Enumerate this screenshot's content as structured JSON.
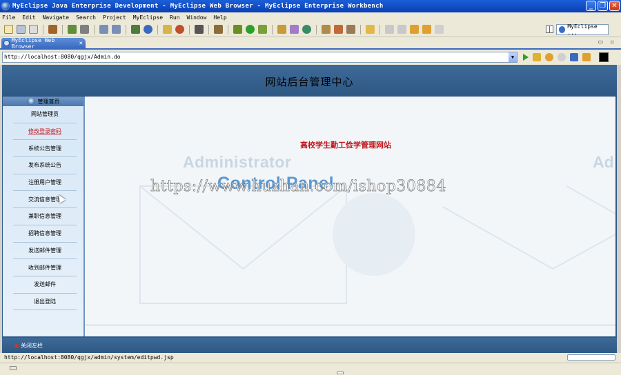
{
  "window": {
    "title": "MyEclipse Java Enterprise Development - MyEclipse Web Browser - MyEclipse Enterprise Workbench"
  },
  "menu": [
    "File",
    "Edit",
    "Navigate",
    "Search",
    "Project",
    "MyEclipse",
    "Run",
    "Window",
    "Help"
  ],
  "perspective": {
    "label": "MyEclipse ..."
  },
  "tab": {
    "label": "MyEclipse Web Browser"
  },
  "address": {
    "url": "http://localhost:8080/qgjx/Admin.do"
  },
  "header": {
    "title": "网站后台管理中心"
  },
  "sidebar": {
    "head": "管理首页",
    "items": [
      {
        "label": "网站管理员"
      },
      {
        "label": "修改登录密码"
      },
      {
        "label": "系统公告管理"
      },
      {
        "label": "发布系统公告"
      },
      {
        "label": "注册用户管理"
      },
      {
        "label": "交流信息管理"
      },
      {
        "label": "兼职信息管理"
      },
      {
        "label": "招聘信息管理"
      },
      {
        "label": "发送邮件管理"
      },
      {
        "label": "收到邮件管理"
      },
      {
        "label": "发送邮件"
      },
      {
        "label": "退出登陆"
      }
    ]
  },
  "content": {
    "site_name": "高校学生勤工俭学管理网站",
    "bg_text_1": "Administrator",
    "bg_text_2": "Ad",
    "bg_text_3": "Control Panel",
    "overlay_url": "https://www.huzhan.com/ishop30884"
  },
  "footer": {
    "close_left": "关闭左栏"
  },
  "status": {
    "url": "http://localhost:8080/qgjx/admin/system/editpwd.jsp"
  },
  "colors": {
    "header_blue": "#2e5884",
    "accent_red": "#c0161a",
    "sidebar_bg": "#d7e7f6"
  }
}
